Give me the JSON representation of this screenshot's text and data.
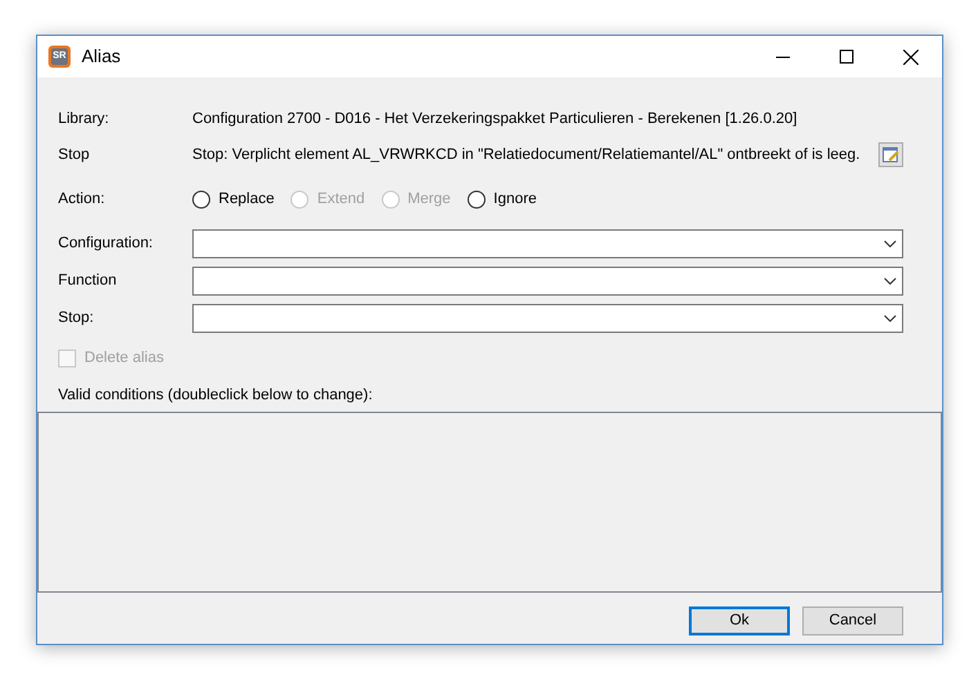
{
  "window": {
    "title": "Alias",
    "app_badge": "SR"
  },
  "info": [
    {
      "label": "Library:",
      "value": "Configuration 2700 - D016 - Het Verzekeringspakket Particulieren - Berekenen [1.26.0.20]",
      "has_button": false
    },
    {
      "label": "Stop",
      "value": "Stop: Verplicht element AL_VRWRKCD in \"Relatiedocument/Relatiemantel/AL\" ontbreekt of is leeg.",
      "has_button": true
    }
  ],
  "action": {
    "label": "Action:",
    "options": [
      {
        "label": "Replace",
        "selected": false,
        "disabled": false
      },
      {
        "label": "Extend",
        "selected": false,
        "disabled": true
      },
      {
        "label": "Merge",
        "selected": false,
        "disabled": true
      },
      {
        "label": "Ignore",
        "selected": false,
        "disabled": false
      }
    ]
  },
  "dropdowns": [
    {
      "label": "Configuration:"
    },
    {
      "label": "Function"
    },
    {
      "label": "Stop:"
    }
  ],
  "delete_alias": {
    "label": "Delete alias",
    "checked": false,
    "disabled": true
  },
  "conditions": {
    "label": "Valid conditions (doubleclick below to change):"
  },
  "buttons": [
    {
      "label": "Ok",
      "default": true
    },
    {
      "label": "Cancel",
      "default": false
    }
  ]
}
